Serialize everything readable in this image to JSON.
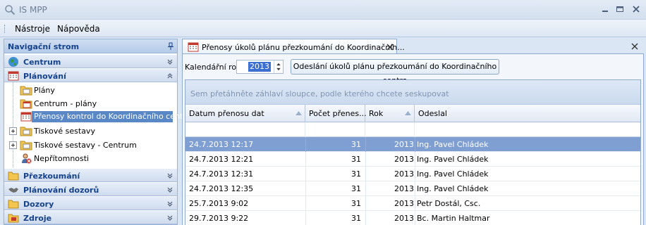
{
  "window": {
    "title": "IS MPP"
  },
  "menu": {
    "items": [
      "Nástroje",
      "Nápověda"
    ]
  },
  "nav": {
    "header": "Navigační strom",
    "groups_top": [
      {
        "label": "Centrum",
        "icon": "globe-icon"
      },
      {
        "label": "Plánování",
        "icon": "calendar-icon"
      }
    ],
    "tree": [
      {
        "label": "Plány",
        "icon": "folder-icon",
        "expandable": false
      },
      {
        "label": "Centrum - plány",
        "icon": "folder-icon",
        "expandable": false
      },
      {
        "label": "Přenosy kontrol do Koordinačního centra",
        "icon": "calendar-grid-icon",
        "expandable": false,
        "selected": true
      },
      {
        "label": "Tiskové sestavy",
        "icon": "folder-icon",
        "expandable": true
      },
      {
        "label": "Tiskové sestavy - Centrum",
        "icon": "folder-icon",
        "expandable": true
      },
      {
        "label": "Nepřítomnosti",
        "icon": "user-absence-icon",
        "expandable": false
      }
    ],
    "groups_bottom": [
      {
        "label": "Přezkoumání",
        "icon": "folder-icon"
      },
      {
        "label": "Plánování dozorů",
        "icon": "handshake-icon"
      },
      {
        "label": "Dozory",
        "icon": "folder-icon"
      },
      {
        "label": "Zdroje",
        "icon": "folder-icon"
      }
    ]
  },
  "document": {
    "tab_label": "Přenosy úkolů plánu přezkoumání do Koordinačníh...",
    "year_label": "Kalendářní rok",
    "year_value": "2013",
    "send_button": "Odeslání úkolů plánu přezkoumání do Koordinačního centra",
    "group_hint": "Sem přetáhněte záhlaví sloupce, podle kterého chcete seskupovat",
    "columns": [
      "Datum přenosu dat",
      "Počet přenes...",
      "Rok",
      "Odeslal"
    ],
    "rows": [
      {
        "date": "24.7.2013 12:17",
        "count": "31",
        "year": "2013",
        "sender": "Ing. Pavel Chládek",
        "selected": true
      },
      {
        "date": "24.7.2013 12:21",
        "count": "31",
        "year": "2013",
        "sender": "Ing. Pavel Chládek"
      },
      {
        "date": "24.7.2013 12:31",
        "count": "31",
        "year": "2013",
        "sender": "Ing. Pavel Chládek"
      },
      {
        "date": "24.7.2013 12:35",
        "count": "31",
        "year": "2013",
        "sender": "Ing. Pavel Chládek"
      },
      {
        "date": "25.7.2013 9:02",
        "count": "31",
        "year": "2013",
        "sender": "Petr Dostál, Csc."
      },
      {
        "date": "29.7.2013 9:22",
        "count": "31",
        "year": "2013",
        "sender": "Bc. Martin Haltmar"
      }
    ]
  },
  "colors": {
    "accent": "#15428b",
    "selection": "#7f9fd3",
    "tree_selection": "#5a88c7"
  }
}
